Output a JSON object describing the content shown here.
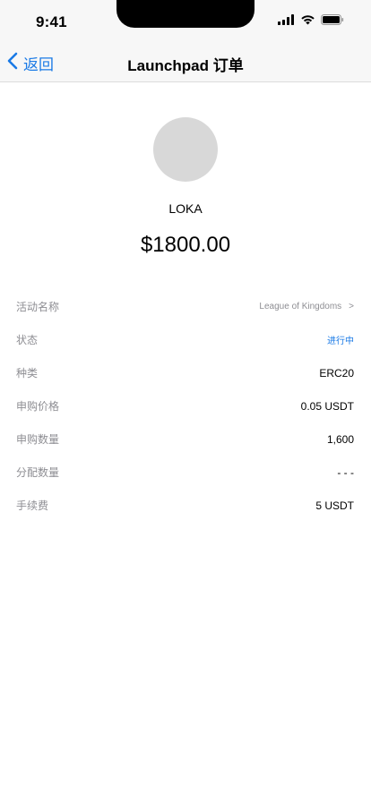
{
  "status_bar": {
    "time": "9:41"
  },
  "nav": {
    "back_label": "返回",
    "title": "Launchpad 订单"
  },
  "token": {
    "name": "LOKA",
    "amount": "$1800.00"
  },
  "details": {
    "activity_label": "活动名称",
    "activity_value": "League of Kingdoms",
    "activity_arrow": ">",
    "status_label": "状态",
    "status_value": "进行中",
    "type_label": "种类",
    "type_value": "ERC20",
    "price_label": "申购价格",
    "price_value": "0.05 USDT",
    "qty_label": "申购数量",
    "qty_value": "1,600",
    "alloc_label": "分配数量",
    "alloc_value": "- - -",
    "fee_label": "手续费",
    "fee_value": "5 USDT"
  },
  "colors": {
    "accent": "#1a7ae6",
    "muted": "#8e8e93",
    "avatar": "#d8d8d8",
    "bar_bg": "#f7f7f7"
  },
  "icons": [
    "cellular-signal-icon",
    "wifi-icon",
    "battery-icon",
    "back-chevron-icon"
  ]
}
